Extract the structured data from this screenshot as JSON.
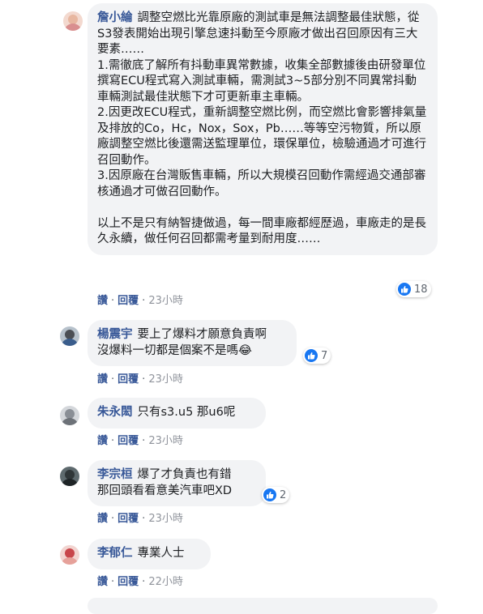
{
  "colors": {
    "link": "#385898",
    "bubble": "#f2f3f5",
    "like": "#1877f2",
    "meta": "#90949c"
  },
  "comments": [
    {
      "author": "詹小綸",
      "paragraphs": [
        "調整空燃比光靠原廠的測試車是無法調整最佳狀態，從S3發表開始出現引擎怠速抖動至今原廠才做出召回原因有三大要素……",
        "1.需徹底了解所有抖動車異常數據，收集全部數據後由研發單位撰寫ECU程式寫入測試車輛，需測試3~5部分別不同異常抖動車輛測試最佳狀態下才可更新車主車輛。",
        "2.因更改ECU程式，重新調整空燃比例，而空燃比會影響排氣量及排放的Co，Hc，Nox，Sox，Pb……等等空污物質，所以原廠調整空燃比後還需送監理單位，環保單位，檢驗通過才可進行召回動作。",
        "3.因原廠在台灣販售車輛，所以大規模召回動作需經過交通部審核通過才可做召回動作。",
        "",
        "以上不是只有納智捷做過，每一間車廠都經歷過，車廠走的是長久永續，做任何召回都需考量到耐用度……"
      ],
      "likes": "18",
      "actions": {
        "like": "讚",
        "reply": "回覆",
        "time": "23小時"
      },
      "avatar_colors": {
        "bg": "#f3d9cf",
        "head": "#e8b7a0",
        "body": "#d98f8f"
      }
    },
    {
      "author": "楊震宇",
      "paragraphs": [
        "要上了爆料才願意負責啊",
        "沒爆料一切都是個案不是嗎😂"
      ],
      "likes": "7",
      "actions": {
        "like": "讚",
        "reply": "回覆",
        "time": "23小時"
      },
      "avatar_colors": {
        "bg": "#b7c2cc",
        "head": "#4b4f55",
        "body": "#3a5d8c"
      }
    },
    {
      "author": "朱永閎",
      "paragraphs": [
        "只有s3.u5 那u6呢"
      ],
      "likes": "",
      "actions": {
        "like": "讚",
        "reply": "回覆",
        "time": "23小時"
      },
      "avatar_colors": {
        "bg": "#d4d7db",
        "head": "#8a8f96",
        "body": "#6d7278"
      }
    },
    {
      "author": "李宗桓",
      "paragraphs": [
        "爆了才負責也有錯",
        "那回頭看看意美汽車吧XD"
      ],
      "likes": "2",
      "actions": {
        "like": "讚",
        "reply": "回覆",
        "time": "23小時"
      },
      "avatar_colors": {
        "bg": "#5e6a6e",
        "head": "#2f3638",
        "body": "#1e2426"
      }
    },
    {
      "author": "李郁仁",
      "paragraphs": [
        "專業人士"
      ],
      "likes": "",
      "actions": {
        "like": "讚",
        "reply": "回覆",
        "time": "22小時"
      },
      "avatar_colors": {
        "bg": "#f2d4d0",
        "head": "#c8464b",
        "body": "#e6a19a"
      }
    }
  ]
}
